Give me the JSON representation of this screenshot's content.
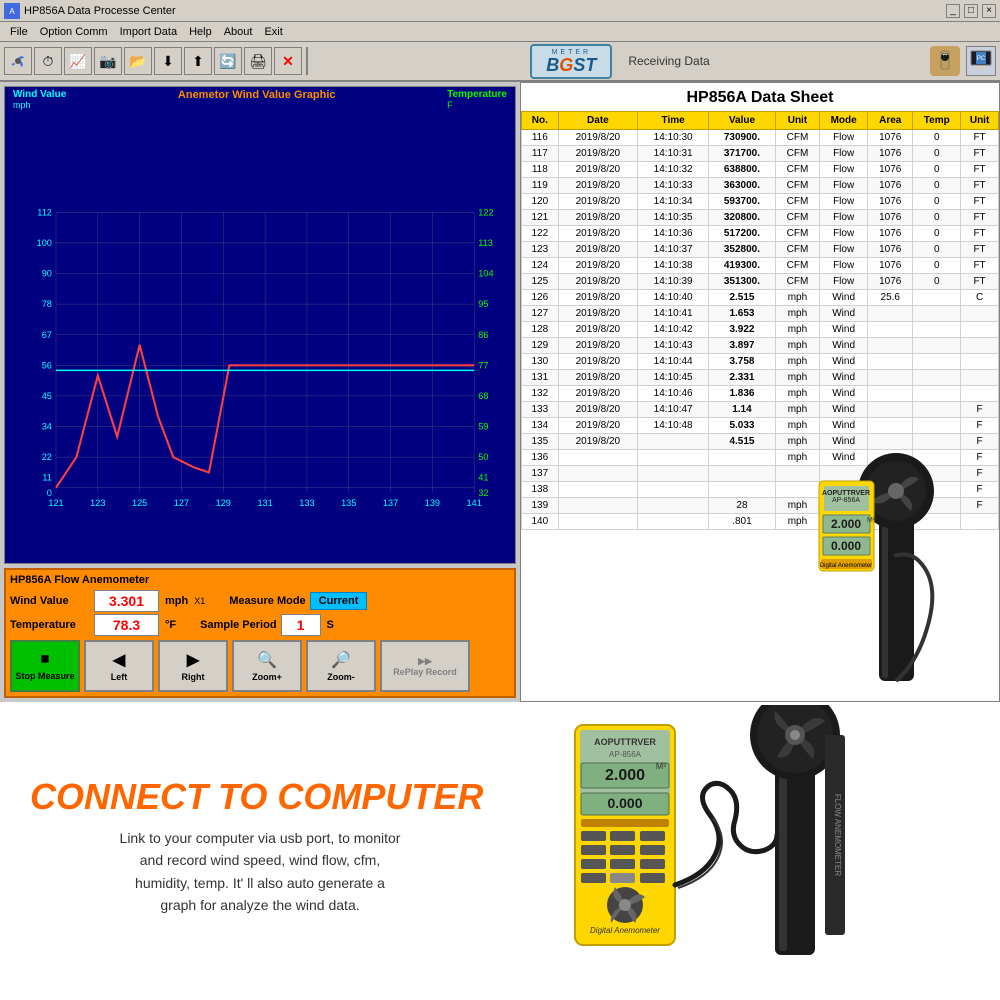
{
  "window": {
    "title": "HP856A Data Processe Center",
    "icon": "●"
  },
  "menu": {
    "items": [
      "File",
      "Option Comm",
      "Import Data",
      "Help",
      "About",
      "Exit"
    ]
  },
  "toolbar": {
    "logo_text": "BGST",
    "logo_meta": "METER",
    "receiving_label": "Receiving Data"
  },
  "chart": {
    "title_left": "Wind Value",
    "title_left_sub": "mph",
    "title_center": "Anemetor Wind Value Graphic",
    "title_right": "Temperature",
    "title_right_sub": "F",
    "y_left_labels": [
      "112",
      "100",
      "90",
      "78",
      "67",
      "56",
      "45",
      "34",
      "22",
      "11",
      "0"
    ],
    "y_right_labels": [
      "122",
      "113",
      "104",
      "95",
      "86",
      "77",
      "68",
      "59",
      "50",
      "41",
      "32"
    ],
    "x_labels": [
      "121",
      "123",
      "125",
      "127",
      "129",
      "131",
      "133",
      "135",
      "137",
      "139",
      "141"
    ]
  },
  "instrument": {
    "title": "HP856A Flow Anemometer",
    "wind_label": "Wind Value",
    "wind_value": "3.301",
    "wind_unit": "mph",
    "wind_x": "X1",
    "mode_label": "Measure Mode",
    "mode_value": "Current",
    "temp_label": "Temperature",
    "temp_value": "78.3",
    "temp_unit": "°F",
    "period_label": "Sample Period",
    "period_value": "1",
    "period_unit": "S"
  },
  "buttons": {
    "stop": "Stop Measure",
    "left": "Left",
    "right": "Right",
    "zoom_plus": "Zoom+",
    "zoom_minus": "Zoom-",
    "replay": "RePlay Record"
  },
  "datasheet": {
    "title": "HP856A Data Sheet",
    "columns": [
      "No.",
      "Date",
      "Time",
      "Value",
      "Unit",
      "Mode",
      "Area",
      "Temp",
      "Unit"
    ],
    "rows": [
      {
        "no": "116",
        "date": "2019/8/20",
        "time": "14:10:30",
        "value": "730900.",
        "unit": "CFM",
        "mode": "Flow",
        "area": "1076",
        "temp": "0",
        "tunit": "FT"
      },
      {
        "no": "117",
        "date": "2019/8/20",
        "time": "14:10:31",
        "value": "371700.",
        "unit": "CFM",
        "mode": "Flow",
        "area": "1076",
        "temp": "0",
        "tunit": "FT"
      },
      {
        "no": "118",
        "date": "2019/8/20",
        "time": "14:10:32",
        "value": "638800.",
        "unit": "CFM",
        "mode": "Flow",
        "area": "1076",
        "temp": "0",
        "tunit": "FT"
      },
      {
        "no": "119",
        "date": "2019/8/20",
        "time": "14:10:33",
        "value": "363000.",
        "unit": "CFM",
        "mode": "Flow",
        "area": "1076",
        "temp": "0",
        "tunit": "FT"
      },
      {
        "no": "120",
        "date": "2019/8/20",
        "time": "14:10:34",
        "value": "593700.",
        "unit": "CFM",
        "mode": "Flow",
        "area": "1076",
        "temp": "0",
        "tunit": "FT"
      },
      {
        "no": "121",
        "date": "2019/8/20",
        "time": "14:10:35",
        "value": "320800.",
        "unit": "CFM",
        "mode": "Flow",
        "area": "1076",
        "temp": "0",
        "tunit": "FT"
      },
      {
        "no": "122",
        "date": "2019/8/20",
        "time": "14:10:36",
        "value": "517200.",
        "unit": "CFM",
        "mode": "Flow",
        "area": "1076",
        "temp": "0",
        "tunit": "FT"
      },
      {
        "no": "123",
        "date": "2019/8/20",
        "time": "14:10:37",
        "value": "352800.",
        "unit": "CFM",
        "mode": "Flow",
        "area": "1076",
        "temp": "0",
        "tunit": "FT"
      },
      {
        "no": "124",
        "date": "2019/8/20",
        "time": "14:10:38",
        "value": "419300.",
        "unit": "CFM",
        "mode": "Flow",
        "area": "1076",
        "temp": "0",
        "tunit": "FT"
      },
      {
        "no": "125",
        "date": "2019/8/20",
        "time": "14:10:39",
        "value": "351300.",
        "unit": "CFM",
        "mode": "Flow",
        "area": "1076",
        "temp": "0",
        "tunit": "FT"
      },
      {
        "no": "126",
        "date": "2019/8/20",
        "time": "14:10:40",
        "value": "2.515",
        "unit": "mph",
        "mode": "Wind",
        "area": "25.6",
        "temp": "",
        "tunit": "C"
      },
      {
        "no": "127",
        "date": "2019/8/20",
        "time": "14:10:41",
        "value": "1.653",
        "unit": "mph",
        "mode": "Wind",
        "area": "",
        "temp": "",
        "tunit": ""
      },
      {
        "no": "128",
        "date": "2019/8/20",
        "time": "14:10:42",
        "value": "3.922",
        "unit": "mph",
        "mode": "Wind",
        "area": "",
        "temp": "",
        "tunit": ""
      },
      {
        "no": "129",
        "date": "2019/8/20",
        "time": "14:10:43",
        "value": "3.897",
        "unit": "mph",
        "mode": "Wind",
        "area": "",
        "temp": "",
        "tunit": ""
      },
      {
        "no": "130",
        "date": "2019/8/20",
        "time": "14:10:44",
        "value": "3.758",
        "unit": "mph",
        "mode": "Wind",
        "area": "",
        "temp": "",
        "tunit": ""
      },
      {
        "no": "131",
        "date": "2019/8/20",
        "time": "14:10:45",
        "value": "2.331",
        "unit": "mph",
        "mode": "Wind",
        "area": "",
        "temp": "",
        "tunit": ""
      },
      {
        "no": "132",
        "date": "2019/8/20",
        "time": "14:10:46",
        "value": "1.836",
        "unit": "mph",
        "mode": "Wind",
        "area": "",
        "temp": "",
        "tunit": ""
      },
      {
        "no": "133",
        "date": "2019/8/20",
        "time": "14:10:47",
        "value": "1.14",
        "unit": "mph",
        "mode": "Wind",
        "area": "",
        "temp": "",
        "tunit": "F"
      },
      {
        "no": "134",
        "date": "2019/8/20",
        "time": "14:10:48",
        "value": "5.033",
        "unit": "mph",
        "mode": "Wind",
        "area": "",
        "temp": "",
        "tunit": "F"
      },
      {
        "no": "135",
        "date": "2019/8/20",
        "time": "",
        "value": "4.515",
        "unit": "mph",
        "mode": "Wind",
        "area": "",
        "temp": "",
        "tunit": "F"
      },
      {
        "no": "136",
        "date": "",
        "time": "",
        "value": "",
        "unit": "mph",
        "mode": "Wind",
        "area": "",
        "temp": "",
        "tunit": "F"
      },
      {
        "no": "137",
        "date": "",
        "time": "",
        "value": "",
        "unit": "",
        "mode": "",
        "area": "",
        "temp": "",
        "tunit": "F"
      },
      {
        "no": "138",
        "date": "",
        "time": "",
        "value": "",
        "unit": "",
        "mode": "",
        "area": "",
        "temp": "",
        "tunit": "F"
      },
      {
        "no": "139",
        "date": "",
        "time": "",
        "value": "28",
        "unit": "mph",
        "mode": "Wind",
        "area": "",
        "temp": "",
        "tunit": "F"
      },
      {
        "no": "140",
        "date": "",
        "time": "",
        "value": ".801",
        "unit": "mph",
        "mode": "Wind",
        "area": "",
        "temp": "",
        "tunit": ""
      }
    ]
  },
  "bottom": {
    "connect_title": "CONNECT TO COMPUTER",
    "desc_line1": "Link to your computer via usb port, to monitor",
    "desc_line2": "and record wind speed, wind flow, cfm,",
    "desc_line3": "humidity, temp. It' ll also auto generate a",
    "desc_line4": "graph for analyze the wind data."
  },
  "device": {
    "brand": "AOPUTTRVER",
    "model": "AP-856A",
    "display_top": "2.000",
    "display_units": "M²",
    "display_bottom": "0.000",
    "label": "Digital Anemometer"
  }
}
